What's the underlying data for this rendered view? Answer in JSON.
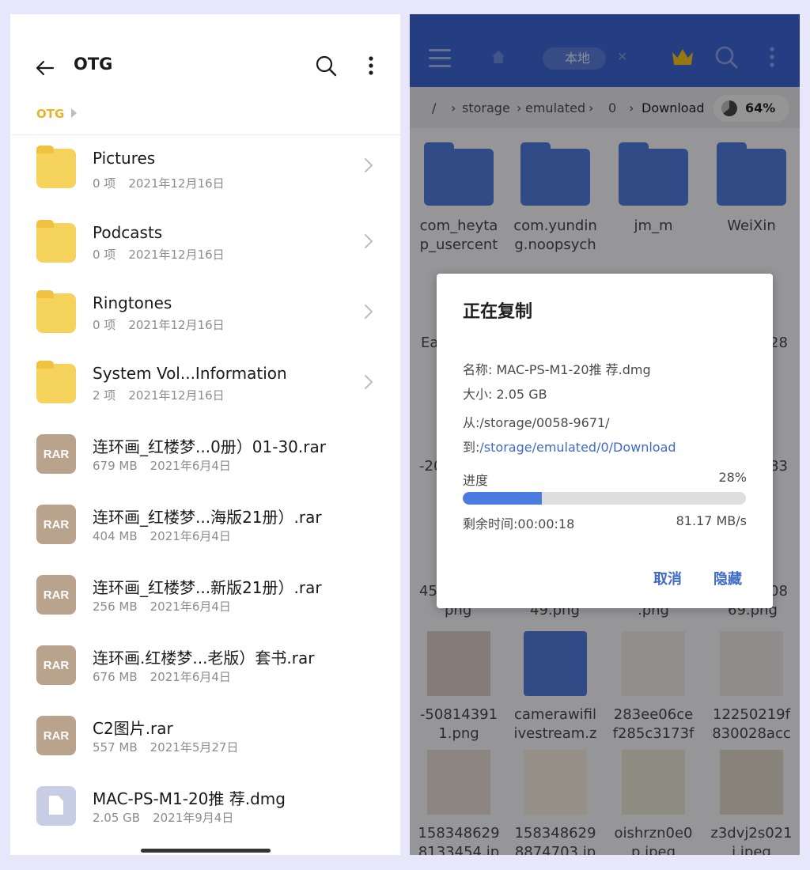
{
  "left": {
    "title": "OTG",
    "breadcrumb": "OTG",
    "items": [
      {
        "type": "folder",
        "name": "Pictures",
        "count": "0 项",
        "date": "2021年12月16日"
      },
      {
        "type": "folder",
        "name": "Podcasts",
        "count": "0 项",
        "date": "2021年12月16日"
      },
      {
        "type": "folder",
        "name": "Ringtones",
        "count": "0 项",
        "date": "2021年12月16日"
      },
      {
        "type": "folder",
        "name": "System Vol...Information",
        "count": "2 项",
        "date": "2021年12月16日"
      },
      {
        "type": "rar",
        "badge": "RAR",
        "name": "连环画_红楼梦...0册）01-30.rar",
        "size": "679 MB",
        "date": "2021年6月4日"
      },
      {
        "type": "rar",
        "badge": "RAR",
        "name": "连环画_红楼梦...海版21册）.rar",
        "size": "404 MB",
        "date": "2021年6月4日"
      },
      {
        "type": "rar",
        "badge": "RAR",
        "name": "连环画_红楼梦...新版21册）.rar",
        "size": "256 MB",
        "date": "2021年6月4日"
      },
      {
        "type": "rar",
        "badge": "RAR",
        "name": "连环画.红楼梦...老版）套书.rar",
        "size": "676 MB",
        "date": "2021年6月4日"
      },
      {
        "type": "rar",
        "badge": "RAR",
        "name": "C2图片.rar",
        "size": "557 MB",
        "date": "2021年5月27日"
      },
      {
        "type": "doc",
        "name": "MAC-PS-M1-20推 荐.dmg",
        "size": "2.05 GB",
        "date": "2021年9月4日"
      }
    ]
  },
  "right": {
    "tab_label": "本地",
    "path": [
      "/",
      "storage",
      "emulated",
      "0",
      "Download"
    ],
    "storage_pct": "64%",
    "grid": [
      {
        "kind": "folder",
        "l1": "com_heyta",
        "l2": "p_usercent"
      },
      {
        "kind": "folder",
        "l1": "com.yundin",
        "l2": "g.noopsych"
      },
      {
        "kind": "folder",
        "l1": "jm_m",
        "l2": ""
      },
      {
        "kind": "folder",
        "l1": "WeiXin",
        "l2": ""
      },
      {
        "kind": "image",
        "l1": "-50814391",
        "l2": "1.png"
      },
      {
        "kind": "zip",
        "l1": "camerawifil",
        "l2": "ivestream.z"
      },
      {
        "kind": "image",
        "l1": "283ee06ce",
        "l2": "f285c3173f"
      },
      {
        "kind": "image",
        "l1": "12250219f",
        "l2": "830028acc"
      },
      {
        "kind": "image",
        "l1": "158348629",
        "l2": "8133454.jp"
      },
      {
        "kind": "image",
        "l1": "158348629",
        "l2": "8874703.jp"
      },
      {
        "kind": "image",
        "l1": "oishrzn0e0",
        "l2": "p.jpeg"
      },
      {
        "kind": "image",
        "l1": "z3dvj2s021",
        "l2": "i.jpeg"
      }
    ],
    "partial": [
      "Ea",
      "28",
      "-20",
      "83",
      "45",
      "08",
      "png",
      "49.png",
      ".png",
      "69.png"
    ],
    "dialog": {
      "title": "正在复制",
      "name_label": "名称: ",
      "name_value": "MAC-PS-M1-20推 荐.dmg",
      "size_label": "大小: ",
      "size_value": "2.05 GB",
      "from_label": "从:",
      "from_value": "/storage/0058-9671/",
      "to_label": "到:",
      "to_value": "/storage/emulated/0/Download",
      "progress_label": "进度",
      "progress_pct": "28%",
      "progress": 0.28,
      "remaining_label": "剩余时间:",
      "remaining_value": "00:00:18",
      "speed": "81.17 MB/s",
      "cancel": "取消",
      "hide": "隐藏"
    }
  },
  "colors": {
    "accent": "#3e6ac9",
    "folder": "#f5d25b",
    "rar": "#b9a38c",
    "toolbar": "#3c64d1",
    "crumb": "#e6b22a"
  }
}
